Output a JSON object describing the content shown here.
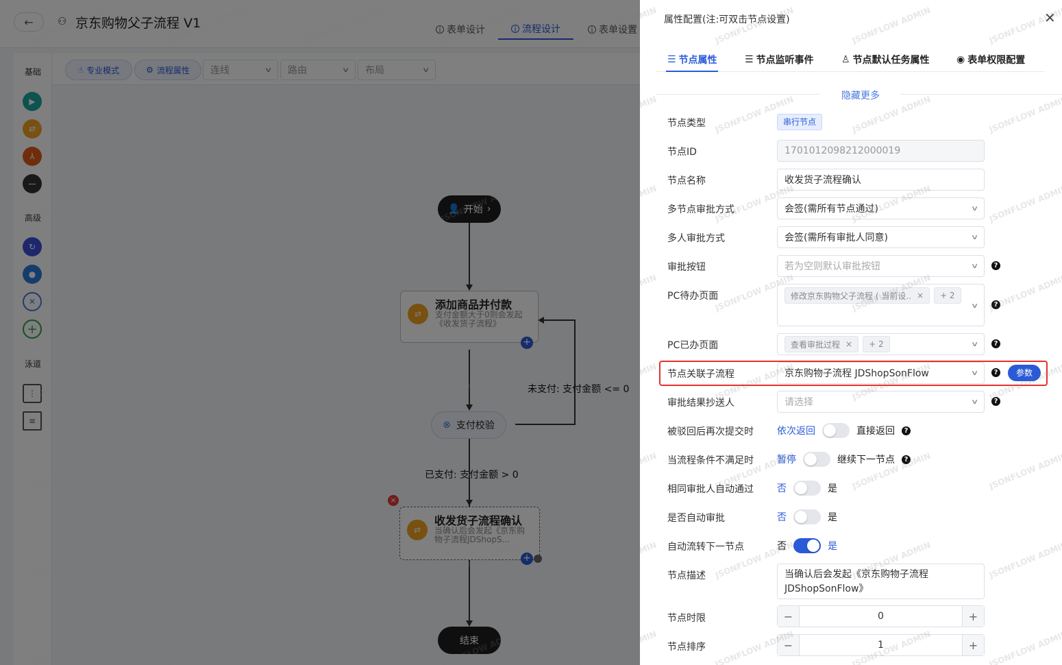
{
  "header": {
    "back_icon": "arrow-left-icon",
    "title": "京东购物父子流程 V1",
    "tabs": [
      {
        "label": "表单设计",
        "active": false
      },
      {
        "label": "流程设计",
        "active": true
      },
      {
        "label": "表单设置",
        "active": false
      }
    ]
  },
  "sidebar": {
    "group_basic": "基础",
    "group_advanced": "高级",
    "group_lane": "泳道"
  },
  "toolbar": {
    "pro_mode": "专业模式",
    "flow_props": "流程属性",
    "select_line": "连线",
    "select_route": "路由",
    "select_layout": "布局"
  },
  "canvas": {
    "start_label": "开始",
    "end_label": "结束",
    "node1_title": "添加商品并付款",
    "node1_desc": "支付金额大于0则会发起《收发货子流程》",
    "gate_label": "支付校验",
    "edge_unpaid": "未支付: 支付金额 <= 0",
    "edge_paid": "已支付: 支付金额 > 0",
    "node2_title": "收发货子流程确认",
    "node2_desc": "当确认后会发起《京东购物子流程JDShopS..."
  },
  "drawer": {
    "title": "属性配置(注:可双击节点设置)",
    "tabs": [
      {
        "label": "节点属性",
        "active": true
      },
      {
        "label": "节点监听事件",
        "active": false
      },
      {
        "label": "节点默认任务属性",
        "active": false
      },
      {
        "label": "表单权限配置",
        "active": false
      }
    ],
    "hide_more": "隐藏更多",
    "fields": {
      "node_type_label": "节点类型",
      "node_type_value": "串行节点",
      "node_id_label": "节点ID",
      "node_id_value": "1701012098212000019",
      "node_name_label": "节点名称",
      "node_name_value": "收发货子流程确认",
      "multi_node_label": "多节点审批方式",
      "multi_node_value": "会签(需所有节点通过)",
      "multi_user_label": "多人审批方式",
      "multi_user_value": "会签(需所有审批人同意)",
      "approve_btn_label": "审批按钮",
      "approve_btn_placeholder": "若为空则默认审批按钮",
      "pc_todo_label": "PC待办页面",
      "pc_todo_tag": "修改京东购物父子流程 ( 当前设...",
      "pc_todo_more": "+ 2",
      "pc_done_label": "PC已办页面",
      "pc_done_tag": "查看审批过程",
      "pc_done_more": "+ 2",
      "subflow_label": "节点关联子流程",
      "subflow_value": "京东购物子流程 JDShopSonFlow",
      "param_button": "参数",
      "cc_label": "审批结果抄送人",
      "cc_placeholder": "请选择",
      "reject_label": "被驳回后再次提交时",
      "reject_on": "依次返回",
      "reject_off": "直接返回",
      "cond_label": "当流程条件不满足时",
      "cond_on": "暂停",
      "cond_off": "继续下一节点",
      "same_label": "相同审批人自动通过",
      "same_no": "否",
      "same_yes": "是",
      "auto_label": "是否自动审批",
      "auto_no": "否",
      "auto_yes": "是",
      "next_label": "自动流转下一节点",
      "next_no": "否",
      "next_yes": "是",
      "desc_label": "节点描述",
      "desc_value": "当确认后会发起《京东购物子流程JDShopSonFlow》",
      "limit_label": "节点时限",
      "limit_value": "0",
      "order_label": "节点排序",
      "order_value": "1"
    },
    "switches": {
      "reject_on": false,
      "cond_on": false,
      "same_on": false,
      "auto_on": false,
      "next_on": true
    }
  },
  "watermark": "JSONFLOW ADMIN",
  "colors": {
    "accent": "#2a5ad8",
    "highlight": "#e6302f",
    "task_icon": "#f0a020"
  }
}
